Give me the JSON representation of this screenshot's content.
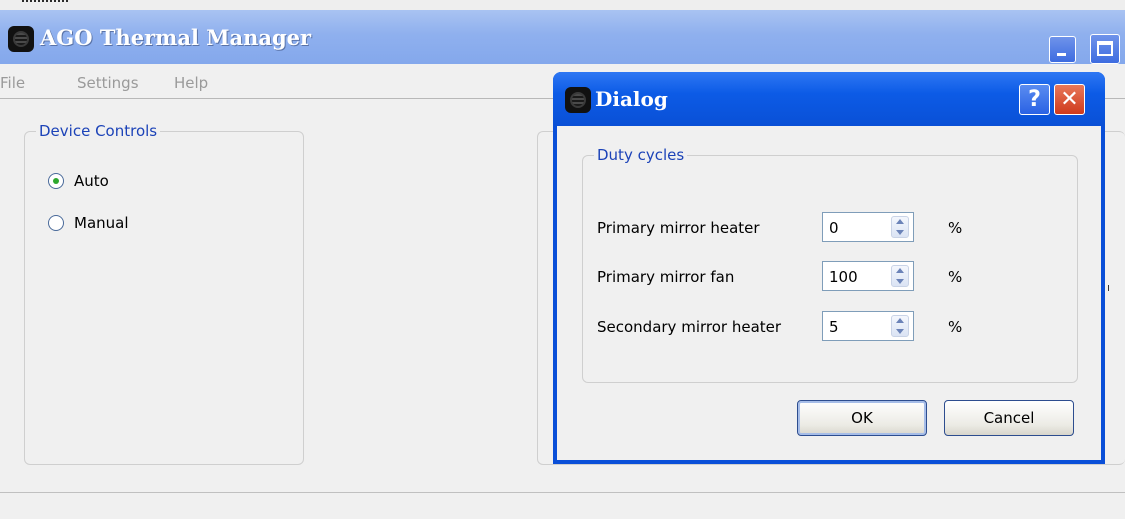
{
  "window": {
    "title": "AGO Thermal Manager"
  },
  "menu": {
    "file": "File",
    "settings": "Settings",
    "help": "Help"
  },
  "device_controls": {
    "legend": "Device Controls",
    "auto_label": "Auto",
    "manual_label": "Manual",
    "selected": "Auto"
  },
  "dialog": {
    "title": "Dialog",
    "help_glyph": "?",
    "close_glyph": "✕",
    "group_legend": "Duty cycles",
    "rows": [
      {
        "label": "Primary mirror heater",
        "value": "0",
        "unit": "%"
      },
      {
        "label": "Primary mirror fan",
        "value": "100",
        "unit": "%"
      },
      {
        "label": "Secondary mirror heater",
        "value": "5",
        "unit": "%"
      }
    ],
    "ok_label": "OK",
    "cancel_label": "Cancel"
  },
  "colors": {
    "titlebar": "#8fb0ee",
    "dialog_frame": "#0a4fd8",
    "legend_text": "#1c43b8",
    "radio_checked": "#2ea82e"
  }
}
